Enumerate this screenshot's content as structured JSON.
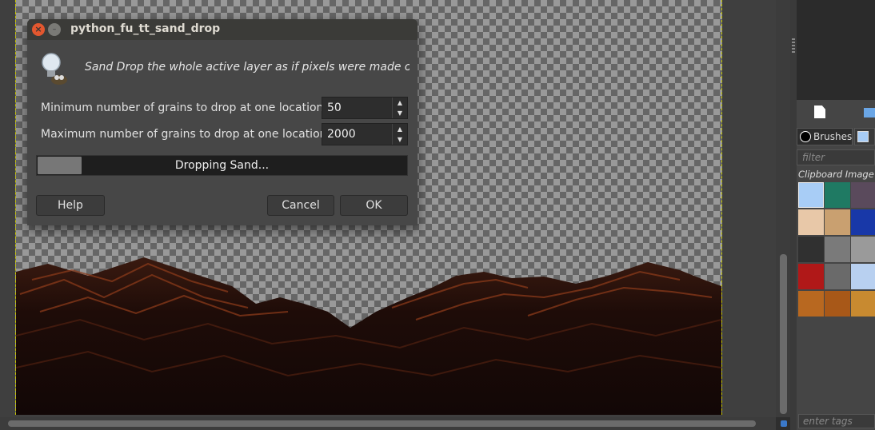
{
  "dialog": {
    "title": "python_fu_tt_sand_drop",
    "description": "Sand Drop the whole active layer as if pixels were made of sand",
    "min_label": "Minimum number of grains to drop at one location:",
    "min_value": "50",
    "max_label": "Maximum number of grains to drop at one location:",
    "max_value": "2000",
    "progress_text": "Dropping Sand...",
    "progress_fraction": 0.12,
    "help": "Help",
    "cancel": "Cancel",
    "ok": "OK"
  },
  "dock": {
    "tab_brushes": "Brushes",
    "filter_placeholder": "filter",
    "pattern_name": "Clipboard Image (",
    "tags_placeholder": "enter tags",
    "patterns": [
      "#a8cdf6",
      "#1f7a63",
      "#5a4a5c",
      "#e8c8a8",
      "#c9a070",
      "#1838a8",
      "#303030",
      "#7a7a7a",
      "#9a9a9a",
      "#b01818",
      "#6a6a6a",
      "#b8d0f0",
      "#b86820",
      "#a85818",
      "#c88a30"
    ]
  },
  "colors": {
    "dialog_bg": "#474747",
    "close": "#e3572f",
    "canvas_guides": "#c8c800"
  }
}
